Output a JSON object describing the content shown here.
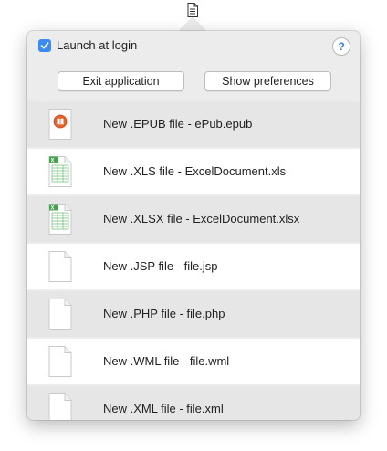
{
  "header": {
    "launch_at_login_label": "Launch at login",
    "launch_at_login_checked": true,
    "help_label": "?",
    "exit_button_label": "Exit application",
    "prefs_button_label": "Show preferences"
  },
  "files": [
    {
      "label": "New .EPUB file - ePub.epub",
      "icon": "epub-file-icon"
    },
    {
      "label": "New .XLS file - ExcelDocument.xls",
      "icon": "spreadsheet-file-icon"
    },
    {
      "label": "New .XLSX file - ExcelDocument.xlsx",
      "icon": "spreadsheet-file-icon"
    },
    {
      "label": "New .JSP file - file.jsp",
      "icon": "blank-file-icon"
    },
    {
      "label": "New .PHP file - file.php",
      "icon": "blank-file-icon"
    },
    {
      "label": "New .WML file - file.wml",
      "icon": "blank-file-icon"
    },
    {
      "label": "New .XML file - file.xml",
      "icon": "blank-file-icon"
    }
  ],
  "colors": {
    "accent": "#3b8bf7",
    "row_alt": "#e6e6e6",
    "popover_bg": "#ececec"
  }
}
